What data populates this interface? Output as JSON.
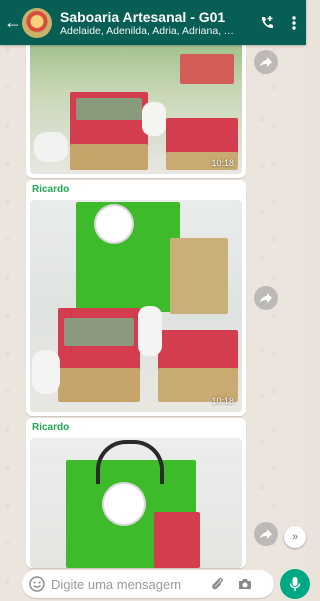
{
  "header": {
    "title": "Saboaria Artesanal - G01",
    "participants": "Adelaide, Adenilda, Adria, Adriana, Agd...",
    "back_icon": "arrow-left-icon",
    "call_icon": "add-call-icon",
    "menu_icon": "more-vert-icon"
  },
  "messages": [
    {
      "sender": "",
      "time": "10:18",
      "type": "image"
    },
    {
      "sender": "Ricardo",
      "time": "10:18",
      "type": "image"
    },
    {
      "sender": "Ricardo",
      "time": "",
      "type": "image"
    }
  ],
  "composer": {
    "placeholder": "Digite uma mensagem",
    "emoji_icon": "emoji-icon",
    "attach_icon": "paperclip-icon",
    "camera_icon": "camera-icon",
    "mic_icon": "mic-icon"
  },
  "colors": {
    "header": "#075e54",
    "sender_name": "#1fa855",
    "mic_button": "#00a884",
    "chat_background": "#ece5dd"
  }
}
